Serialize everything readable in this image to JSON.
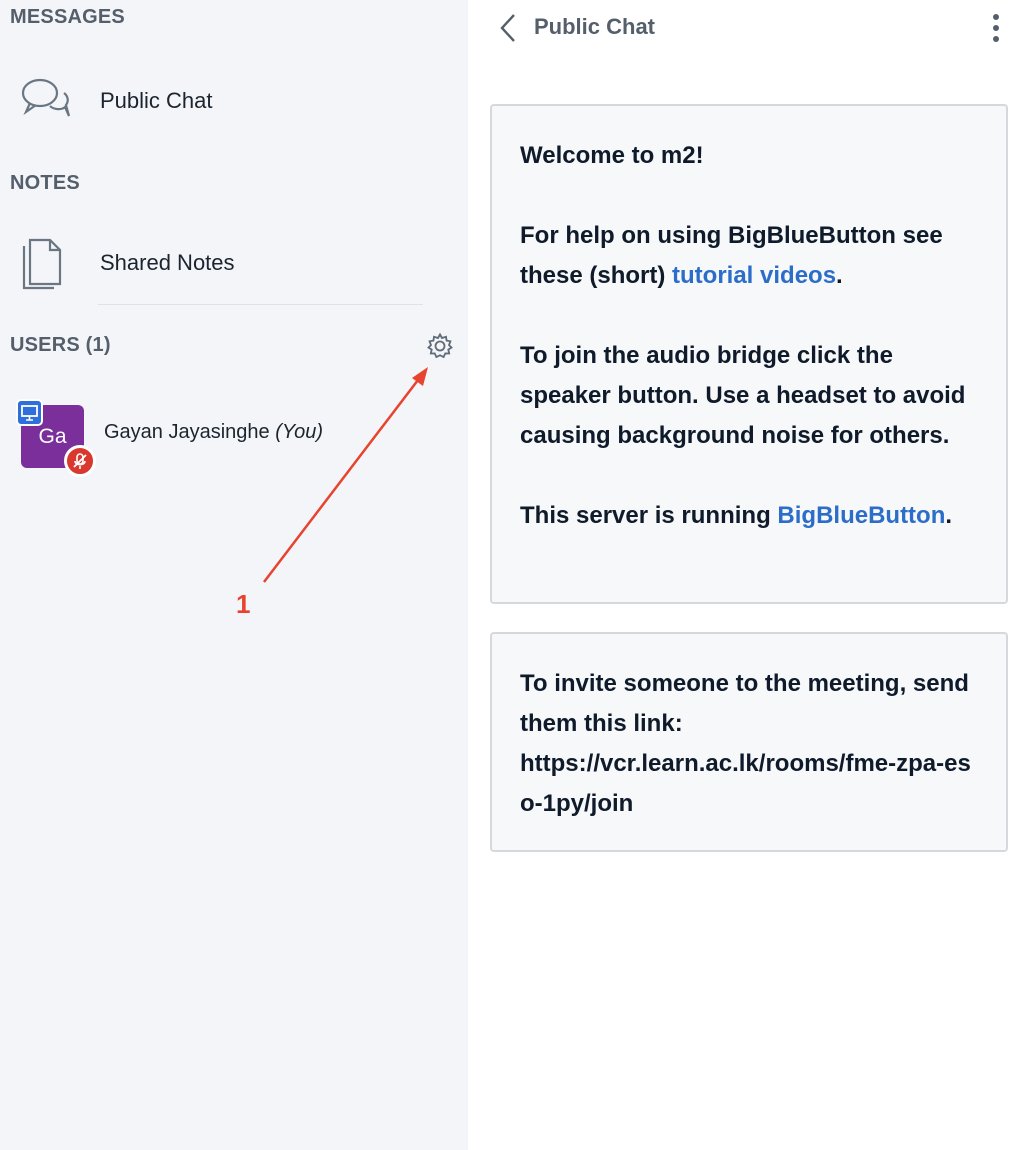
{
  "sidebar": {
    "messages_title": "MESSAGES",
    "public_chat_label": "Public Chat",
    "notes_title": "NOTES",
    "shared_notes_label": "Shared Notes",
    "users_title": "USERS (1)",
    "user": {
      "initials": "Ga",
      "name": "Gayan Jayasinghe",
      "you_tag": "(You)",
      "avatar_color": "#7a2f9b"
    },
    "icons": [
      "chat-bubbles-icon",
      "document-icon",
      "gear-icon",
      "presenter-icon",
      "mic-muted-icon"
    ]
  },
  "annotation": {
    "number": "1",
    "color": "#e8432f"
  },
  "chat": {
    "title": "Public Chat",
    "icons": [
      "chevron-left-icon",
      "more-vertical-icon"
    ],
    "welcome": {
      "line1_prefix": "Welcome to ",
      "meeting_name": "m2",
      "line1_suffix": "!",
      "help_prefix": "For help on using BigBlueButton see these (short) ",
      "help_link": "tutorial videos",
      "help_suffix": ".",
      "audio_text": "To join the audio bridge click the speaker button. Use a headset to avoid causing background noise for others.",
      "server_prefix": "This server is running ",
      "server_link": "BigBlueButton",
      "server_suffix": "."
    },
    "invite": {
      "text": "To invite someone to the meeting, send them this link:",
      "url": "https://vcr.learn.ac.lk/rooms/fme-zpa-eso-1py/join"
    },
    "link_color": "#2b6dc9"
  }
}
